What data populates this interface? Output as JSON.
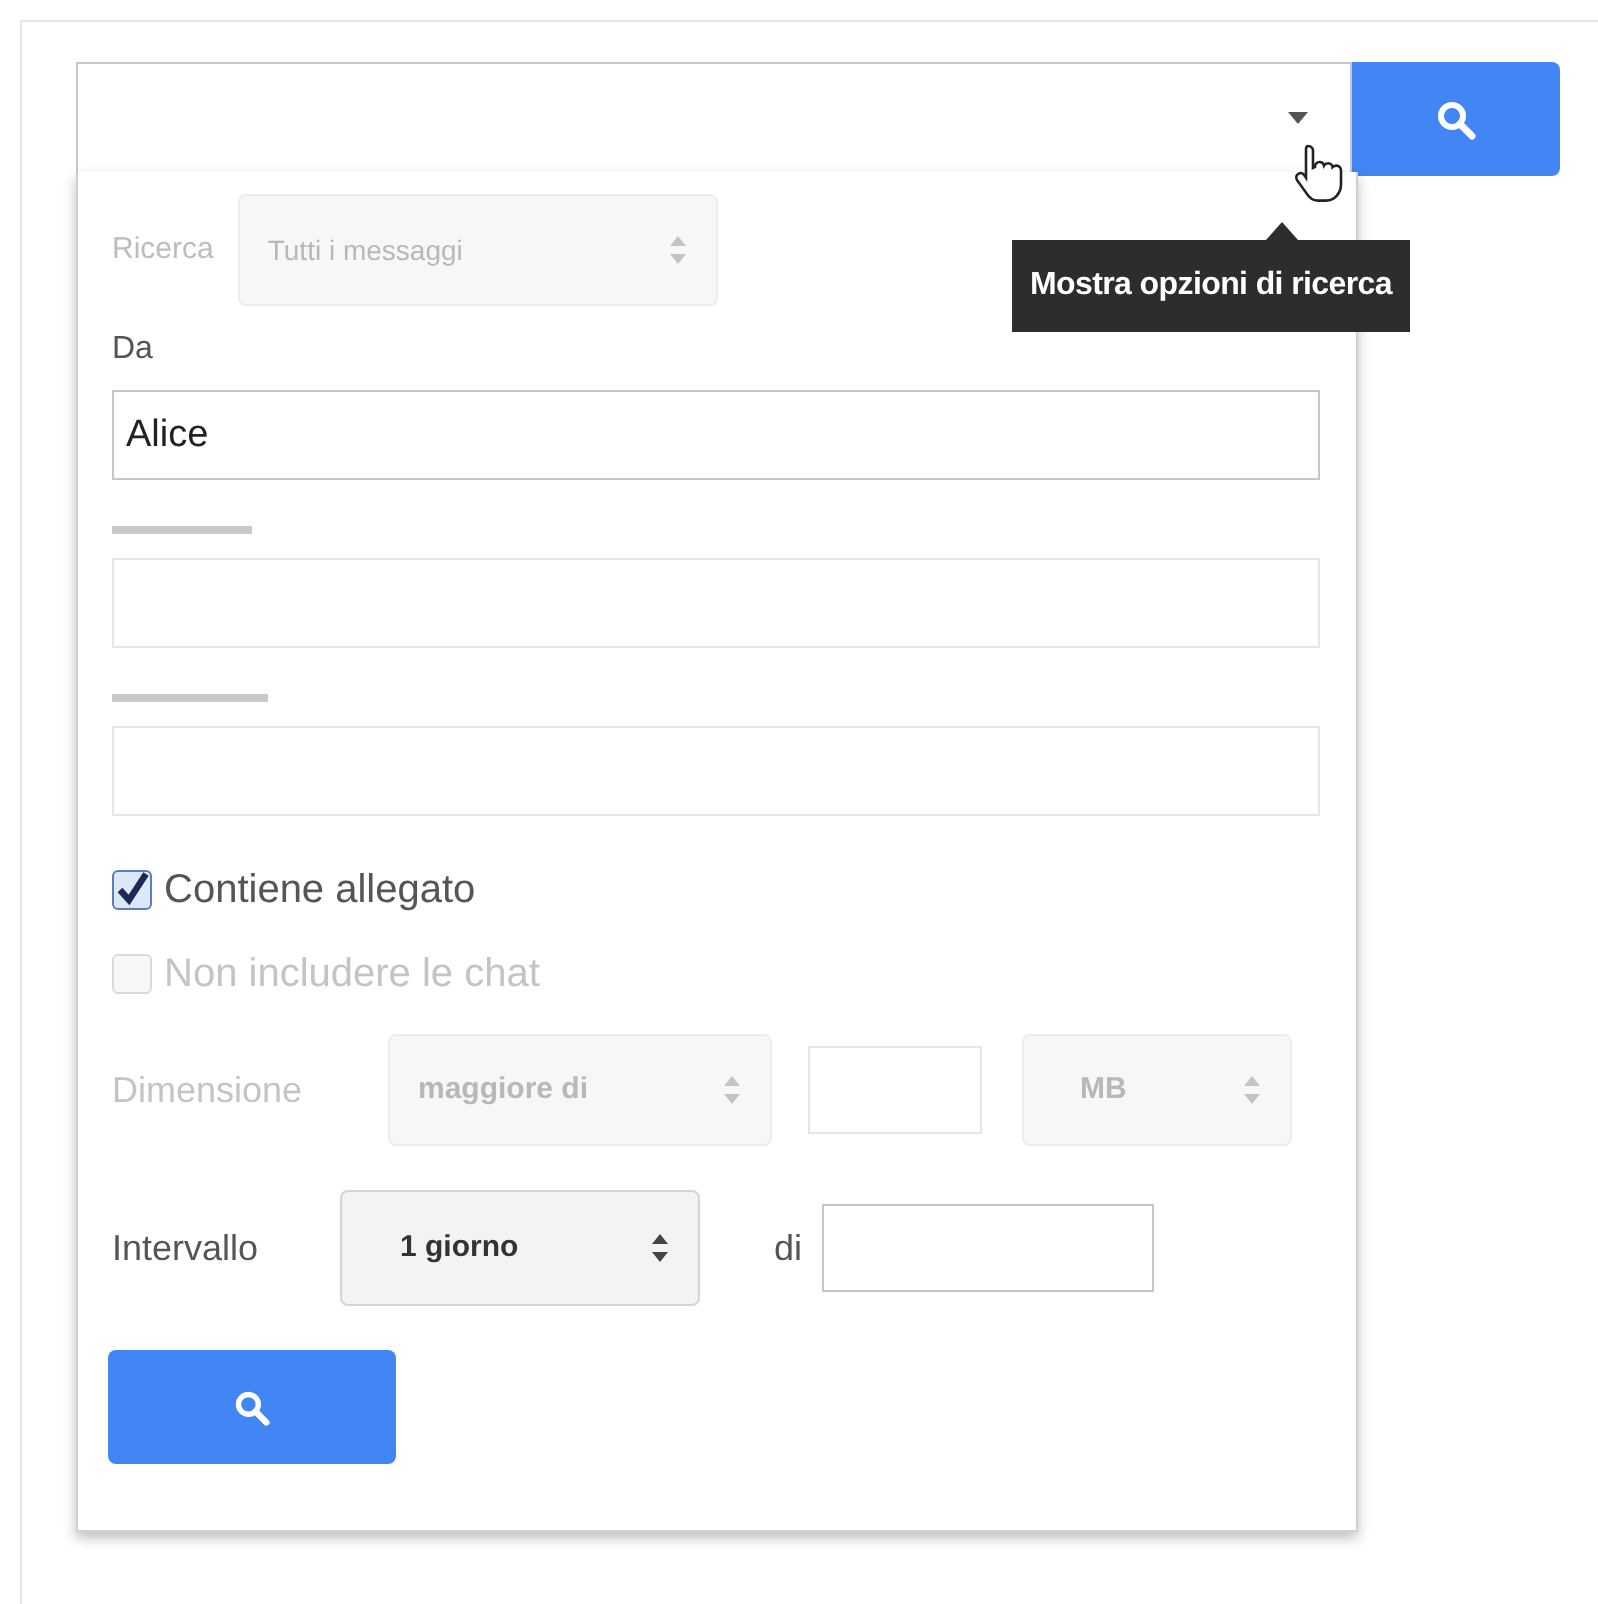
{
  "search_bar": {
    "tooltip": "Mostra opzioni di ricerca"
  },
  "panel": {
    "search_in": {
      "label": "Ricerca",
      "value": "Tutti i messaggi",
      "disabled": true
    },
    "from": {
      "label": "Da",
      "value": "Alice"
    },
    "blank_fields": [
      {
        "kind": "redacted"
      },
      {
        "kind": "redacted"
      }
    ],
    "checkboxes": [
      {
        "label": "Contiene allegato",
        "checked": true,
        "disabled": false
      },
      {
        "label": "Non includere le chat",
        "checked": false,
        "disabled": true
      }
    ],
    "size": {
      "label": "Dimensione",
      "comparison": "maggiore di",
      "unit": "MB",
      "disabled": true
    },
    "range": {
      "label": "Intervallo",
      "value": "1 giorno",
      "of_label": "di"
    }
  }
}
